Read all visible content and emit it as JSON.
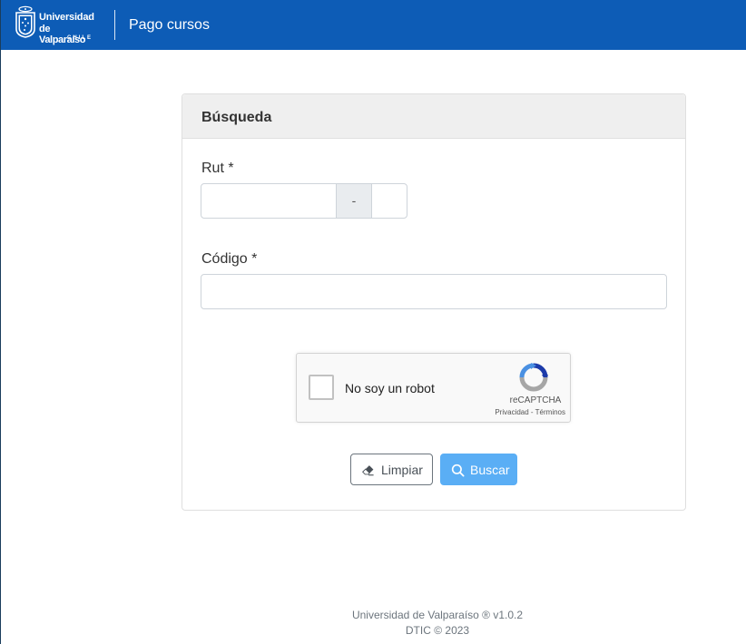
{
  "navbar": {
    "logo": {
      "line1": "Universidad",
      "line2": "de Valparaíso",
      "line3": "CHILE"
    },
    "title": "Pago cursos",
    "background_color": "#0d5cb6"
  },
  "form": {
    "header": "Búsqueda",
    "rut": {
      "label": "Rut *",
      "value": "",
      "separator": "-",
      "dv_value": ""
    },
    "codigo": {
      "label": "Código *",
      "value": ""
    },
    "captcha": {
      "checkbox_label": "No soy un robot",
      "brand": "reCAPTCHA",
      "links": "Privacidad - Términos",
      "checked": false
    },
    "buttons": {
      "clear_label": "Limpiar",
      "clear_icon": "eraser-icon",
      "search_label": "Buscar",
      "search_icon": "search-icon",
      "search_color": "#5aaef5"
    }
  },
  "footer": {
    "line1": "Universidad de Valparaíso ® v1.0.2",
    "line2": "DTIC © 2023"
  }
}
